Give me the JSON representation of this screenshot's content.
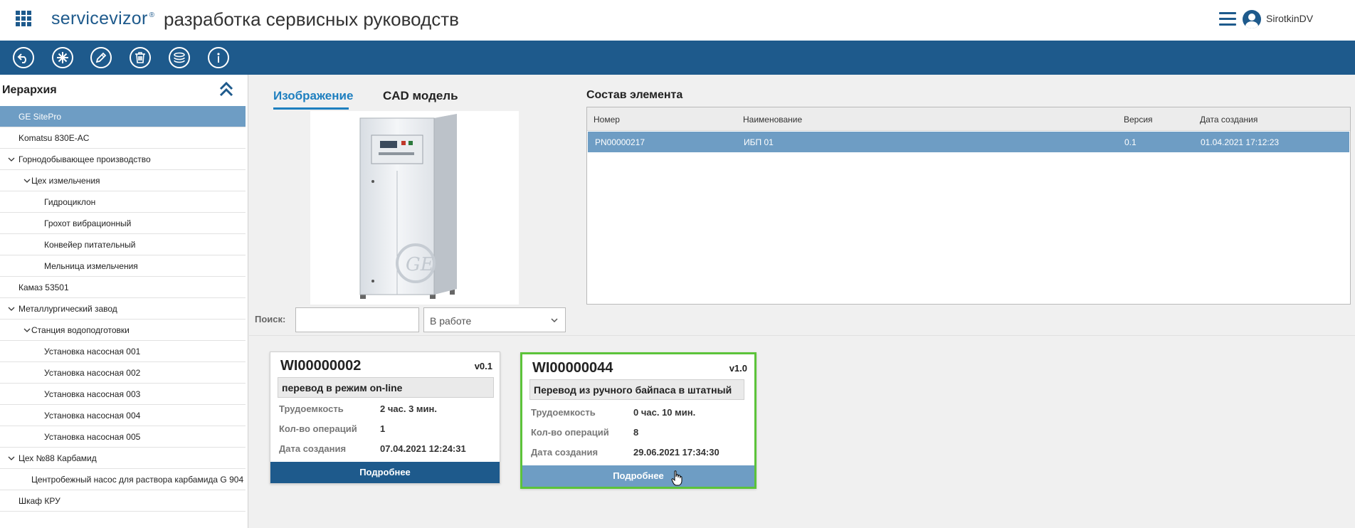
{
  "header": {
    "brand": "servicevizor",
    "brand_mark": "®",
    "app_title": "разработка сервисных руководств",
    "user_name": "SirotkinDV"
  },
  "toolbar": {
    "buttons": [
      {
        "name": "back",
        "icon": "undo-arrow-icon"
      },
      {
        "name": "new",
        "icon": "asterisk-icon"
      },
      {
        "name": "edit",
        "icon": "pencil-icon"
      },
      {
        "name": "delete",
        "icon": "trash-icon"
      },
      {
        "name": "layers",
        "icon": "layers-icon"
      },
      {
        "name": "info",
        "icon": "info-icon"
      }
    ],
    "color": "#1e5a8c"
  },
  "sidebar": {
    "title": "Иерархия",
    "items": [
      {
        "label": "GE SitePro",
        "level": 0,
        "expandable": false,
        "selected": true
      },
      {
        "label": "Komatsu 830E-AC",
        "level": 0,
        "expandable": false
      },
      {
        "label": "Горнодобывающее производство",
        "level": 0,
        "expandable": true
      },
      {
        "label": "Цех измельчения",
        "level": 1,
        "expandable": true
      },
      {
        "label": "Гидроциклон",
        "level": 2,
        "expandable": false
      },
      {
        "label": "Грохот вибрационный",
        "level": 2,
        "expandable": false
      },
      {
        "label": "Конвейер питательный",
        "level": 2,
        "expandable": false
      },
      {
        "label": "Мельница измельчения",
        "level": 2,
        "expandable": false
      },
      {
        "label": "Камаз 53501",
        "level": 0,
        "expandable": false
      },
      {
        "label": "Металлургический завод",
        "level": 0,
        "expandable": true
      },
      {
        "label": "Станция водоподготовки",
        "level": 1,
        "expandable": true
      },
      {
        "label": "Установка насосная 001",
        "level": 2,
        "expandable": false
      },
      {
        "label": "Установка насосная 002",
        "level": 2,
        "expandable": false
      },
      {
        "label": "Установка насосная 003",
        "level": 2,
        "expandable": false
      },
      {
        "label": "Установка насосная 004",
        "level": 2,
        "expandable": false
      },
      {
        "label": "Установка насосная 005",
        "level": 2,
        "expandable": false
      },
      {
        "label": "Цех №88 Карбамид",
        "level": 0,
        "expandable": true
      },
      {
        "label": "Центробежный насос для раствора карбамида G 904",
        "level": 1,
        "expandable": false
      },
      {
        "label": "Шкаф КРУ",
        "level": 0,
        "expandable": false
      }
    ]
  },
  "tabs": {
    "image": "Изображение",
    "cad": "CAD модель",
    "active": "image"
  },
  "composition": {
    "title": "Состав элемента",
    "columns": [
      "Номер",
      "Наименование",
      "Версия",
      "Дата создания"
    ],
    "rows": [
      {
        "number": "PN00000217",
        "name": "ИБП 01",
        "version": "0.1",
        "created": "01.04.2021 17:12:23",
        "selected": true
      }
    ]
  },
  "filter": {
    "search_label": "Поиск:",
    "search_value": "",
    "status": "В работе"
  },
  "cards": [
    {
      "id": "WI00000002",
      "version": "v0.1",
      "subtitle": "перевод в режим on-line",
      "labor_label": "Трудоемкость",
      "labor": "2 час. 3 мин.",
      "ops_label": "Кол-во операций",
      "ops": "1",
      "date_label": "Дата создания",
      "date": "07.04.2021 12:24:31",
      "button": "Подробнее"
    },
    {
      "id": "WI00000044",
      "version": "v1.0",
      "subtitle": "Перевод из ручного байпаса в штатный",
      "labor_label": "Трудоемкость",
      "labor": "0 час. 10 мин.",
      "ops_label": "Кол-во операций",
      "ops": "8",
      "date_label": "Дата создания",
      "date": "29.06.2021 17:34:30",
      "button": "Подробнее",
      "highlighted": true
    }
  ],
  "colors": {
    "primary": "#1e5a8c",
    "selection": "#6e9dc4",
    "tab_active": "#1e7fbf",
    "highlight_border": "#5cc33a"
  }
}
